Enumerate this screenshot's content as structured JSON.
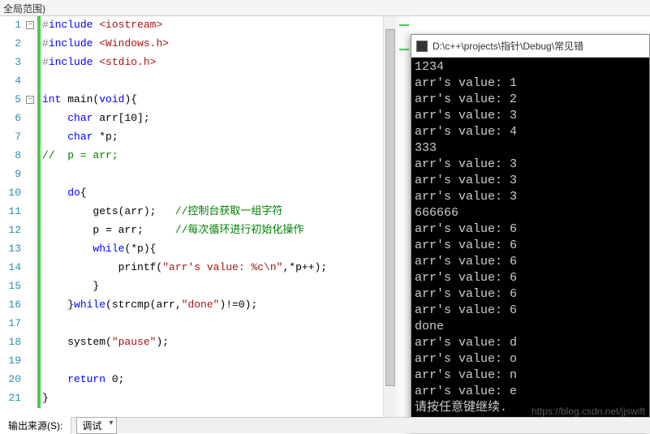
{
  "top_bar": "全局范围)",
  "lines": [
    {
      "n": 1,
      "html": "<span class='kw-pp'>#</span><span class='kw-include'>include</span> <span class='ang'>&lt;iostream&gt;</span>"
    },
    {
      "n": 2,
      "html": "<span class='kw-pp'>#</span><span class='kw-include'>include</span> <span class='ang'>&lt;Windows.h&gt;</span>"
    },
    {
      "n": 3,
      "html": "<span class='kw-pp'>#</span><span class='kw-include'>include</span> <span class='ang'>&lt;stdio.h&gt;</span>"
    },
    {
      "n": 4,
      "html": ""
    },
    {
      "n": 5,
      "html": "<span class='kw-blue'>int</span> main(<span class='kw-blue'>void</span>){"
    },
    {
      "n": 6,
      "html": "    <span class='kw-blue'>char</span> arr[10];"
    },
    {
      "n": 7,
      "html": "    <span class='kw-blue'>char</span> *p;"
    },
    {
      "n": 8,
      "html": "<span class='comment'>//  p = arr;</span>"
    },
    {
      "n": 9,
      "html": ""
    },
    {
      "n": 10,
      "html": "    <span class='kw-blue'>do</span>{"
    },
    {
      "n": 11,
      "html": "        gets(arr);   <span class='comment'>//控制台获取一组字符</span>"
    },
    {
      "n": 12,
      "html": "        p = arr;     <span class='comment'>//每次循环进行初始化操作</span>"
    },
    {
      "n": 13,
      "html": "        <span class='kw-blue'>while</span>(*p){"
    },
    {
      "n": 14,
      "html": "            printf(<span class='str'>\"arr's value: %c\\n\"</span>,*p++);"
    },
    {
      "n": 15,
      "html": "        }"
    },
    {
      "n": 16,
      "html": "    }<span class='kw-blue'>while</span>(strcmp(arr,<span class='str'>\"done\"</span>)!=0);"
    },
    {
      "n": 17,
      "html": ""
    },
    {
      "n": 18,
      "html": "    system(<span class='str'>\"pause\"</span>);"
    },
    {
      "n": 19,
      "html": ""
    },
    {
      "n": 20,
      "html": "    <span class='kw-blue'>return</span> 0;"
    },
    {
      "n": 21,
      "html": "}"
    }
  ],
  "fold_boxes": [
    {
      "line": 1,
      "sym": "−"
    },
    {
      "line": 5,
      "sym": "−"
    }
  ],
  "console": {
    "title": "D:\\c++\\projects\\指针\\Debug\\常见错",
    "output": "1234\narr's value: 1\narr's value: 2\narr's value: 3\narr's value: 4\n333\narr's value: 3\narr's value: 3\narr's value: 3\n666666\narr's value: 6\narr's value: 6\narr's value: 6\narr's value: 6\narr's value: 6\narr's value: 6\ndone\narr's value: d\narr's value: o\narr's value: n\narr's value: e\n请按任意键继续."
  },
  "bottom": {
    "tab": "输出来源(S):",
    "dropdown": "调试"
  },
  "watermark": "https://blog.csdn.net/jjswift"
}
